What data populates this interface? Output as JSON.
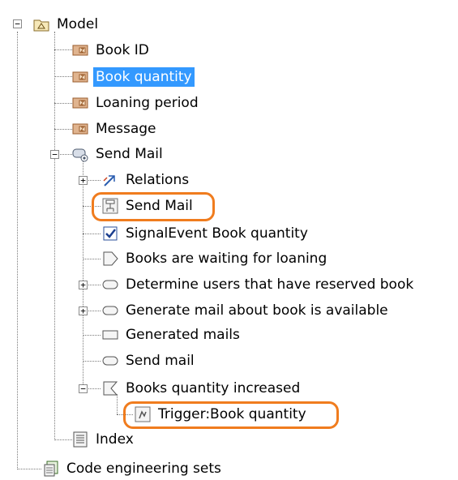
{
  "tree": {
    "model": {
      "label": "Model",
      "icon": "model-package-icon",
      "expanded": true
    },
    "items": [
      {
        "label": "Book ID",
        "icon": "string-property-icon"
      },
      {
        "label": "Book quantity",
        "icon": "string-property-icon",
        "selected": true
      },
      {
        "label": "Loaning period",
        "icon": "string-property-icon"
      },
      {
        "label": "Message",
        "icon": "string-property-icon"
      }
    ],
    "send_mail_activity": {
      "label": "Send Mail",
      "icon": "activity-icon",
      "expanded": true,
      "children": [
        {
          "label": "Relations",
          "icon": "relations-icon",
          "collapsed": true
        },
        {
          "label": "Send Mail",
          "icon": "diagram-icon",
          "highlighted": true
        },
        {
          "label": "SignalEvent Book quantity",
          "icon": "signal-event-checkbox-icon"
        },
        {
          "label": "Books are waiting  for loaning",
          "icon": "accept-event-icon"
        },
        {
          "label": "Determine users that have reserved book",
          "icon": "action-icon",
          "collapsed": true
        },
        {
          "label": "Generate mail about  book is available",
          "icon": "action-icon",
          "collapsed": true
        },
        {
          "label": "Generated  mails",
          "icon": "object-node-icon"
        },
        {
          "label": "Send mail",
          "icon": "action-icon"
        },
        {
          "label": "Books quantity increased",
          "icon": "event-icon",
          "expanded": true
        },
        {
          "label": "Trigger:Book quantity",
          "icon": "trigger-icon",
          "highlighted": true
        }
      ]
    },
    "index": {
      "label": "Index",
      "icon": "index-icon"
    },
    "code_sets": {
      "label": "Code engineering sets",
      "icon": "code-engineering-icon"
    }
  },
  "colors": {
    "selection": "#3399ff",
    "highlight_ring": "#f07c1e",
    "tree_line": "#7a7a7a"
  }
}
